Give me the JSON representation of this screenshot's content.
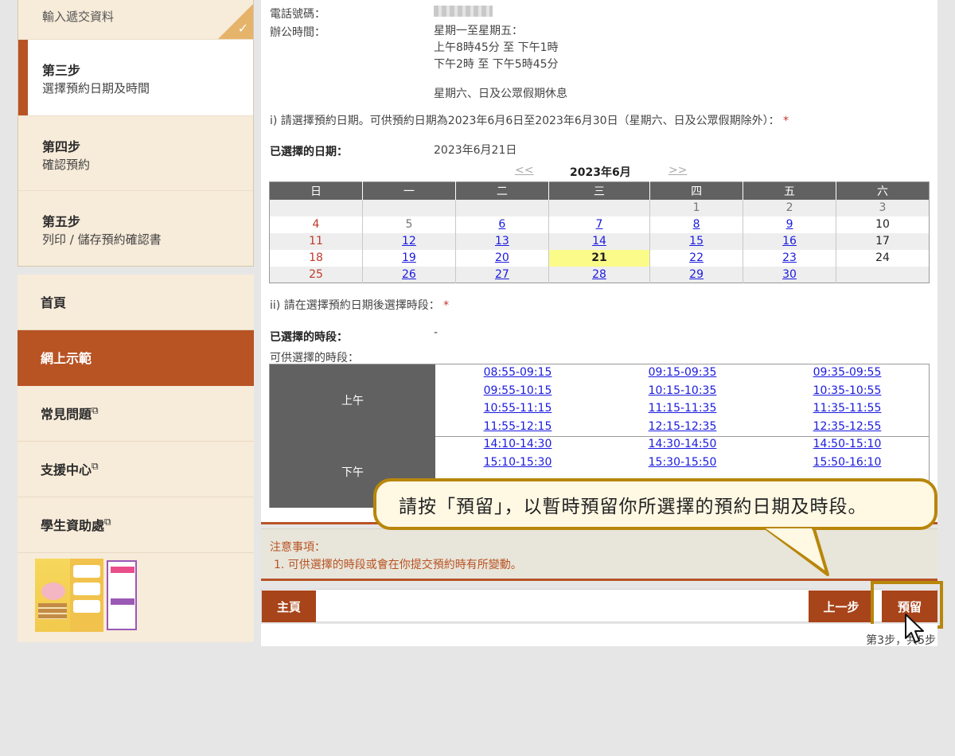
{
  "steps": [
    {
      "title": "",
      "sub": "輸入遞交資料",
      "state": "done"
    },
    {
      "title": "第三步",
      "sub": "選擇預約日期及時間",
      "state": "active"
    },
    {
      "title": "第四步",
      "sub": "確認預約",
      "state": "pending"
    },
    {
      "title": "第五步",
      "sub": "列印 / 儲存預約確認書",
      "state": "pending"
    }
  ],
  "menu": [
    {
      "label": "首頁",
      "external": false,
      "active": false
    },
    {
      "label": "網上示範",
      "external": false,
      "active": true
    },
    {
      "label": "常見問題",
      "external": true,
      "active": false
    },
    {
      "label": "支援中心",
      "external": true,
      "active": false
    },
    {
      "label": "學生資助處",
      "external": true,
      "active": false
    }
  ],
  "office": {
    "phone_label": "電話號碼：",
    "hours_label": "辦公時間：",
    "hours": [
      "星期一至星期五：",
      "上午8時45分 至 下午1時",
      "下午2時 至 下午5時45分"
    ],
    "closed": "星期六、日及公眾假期休息"
  },
  "date_section": {
    "instruction": "i) 請選擇預約日期。可供預約日期為2023年6月6日至2023年6月30日（星期六、日及公眾假期除外）：",
    "required_mark": "*",
    "selected_label": "已選擇的日期：",
    "selected_value": "2023年6月21日"
  },
  "calendar": {
    "prev": "<<",
    "next": ">>",
    "month": "2023年6月",
    "weekdays": [
      "日",
      "一",
      "二",
      "三",
      "四",
      "五",
      "六"
    ],
    "rows": [
      [
        {
          "d": ""
        },
        {
          "d": ""
        },
        {
          "d": ""
        },
        {
          "d": ""
        },
        {
          "d": "1",
          "s": "grey"
        },
        {
          "d": "2",
          "s": "grey"
        },
        {
          "d": "3",
          "s": "grey"
        }
      ],
      [
        {
          "d": "4",
          "s": "sun"
        },
        {
          "d": "5",
          "s": "grey"
        },
        {
          "d": "6",
          "s": "link"
        },
        {
          "d": "7",
          "s": "link"
        },
        {
          "d": "8",
          "s": "link"
        },
        {
          "d": "9",
          "s": "link"
        },
        {
          "d": "10",
          "s": "black"
        }
      ],
      [
        {
          "d": "11",
          "s": "sun"
        },
        {
          "d": "12",
          "s": "link"
        },
        {
          "d": "13",
          "s": "link"
        },
        {
          "d": "14",
          "s": "link"
        },
        {
          "d": "15",
          "s": "link"
        },
        {
          "d": "16",
          "s": "link"
        },
        {
          "d": "17",
          "s": "black"
        }
      ],
      [
        {
          "d": "18",
          "s": "sun"
        },
        {
          "d": "19",
          "s": "link"
        },
        {
          "d": "20",
          "s": "link"
        },
        {
          "d": "21",
          "s": "sel"
        },
        {
          "d": "22",
          "s": "link"
        },
        {
          "d": "23",
          "s": "link"
        },
        {
          "d": "24",
          "s": "black"
        }
      ],
      [
        {
          "d": "25",
          "s": "sun"
        },
        {
          "d": "26",
          "s": "link"
        },
        {
          "d": "27",
          "s": "link"
        },
        {
          "d": "28",
          "s": "link"
        },
        {
          "d": "29",
          "s": "link"
        },
        {
          "d": "30",
          "s": "link"
        },
        {
          "d": ""
        }
      ]
    ]
  },
  "time_section": {
    "instruction": "ii) 請在選擇預約日期後選擇時段：",
    "required_mark": "*",
    "selected_label": "已選擇的時段：",
    "selected_value": "-",
    "available_label": "可供選擇的時段：",
    "morning_label": "上午",
    "afternoon_label": "下午",
    "morning": [
      "08:55-09:15",
      "09:15-09:35",
      "09:35-09:55",
      "09:55-10:15",
      "10:15-10:35",
      "10:35-10:55",
      "10:55-11:15",
      "11:15-11:35",
      "11:35-11:55",
      "11:55-12:15",
      "12:15-12:35",
      "12:35-12:55"
    ],
    "afternoon": [
      "14:10-14:30",
      "14:30-14:50",
      "14:50-15:10",
      "15:10-15:30",
      "15:30-15:50",
      "15:50-16:10"
    ]
  },
  "notes": {
    "title": "注意事項：",
    "items": [
      "1. 可供選擇的時段或會在你提交預約時有所變動。"
    ]
  },
  "buttons": {
    "home": "主頁",
    "prev": "上一步",
    "reserve": "預留"
  },
  "step_count": "第3步，共5步",
  "callout": "請按「預留」，以暫時預留你所選擇的預約日期及時段。",
  "colors": {
    "brand": "#b85324",
    "highlight": "#b8860b",
    "link": "#1a1adf",
    "selected_day": "#fbfb8a"
  }
}
